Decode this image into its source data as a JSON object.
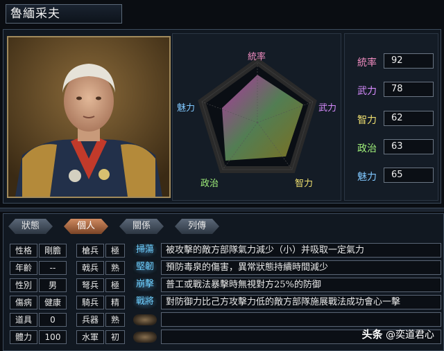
{
  "title": "魯緬采夫",
  "colors": {
    "radar_label_accent": "#f08cc0",
    "stat_pink": "#f08cc0",
    "stat_purple": "#d88cff",
    "stat_yellow": "#f0e070",
    "stat_green": "#a0f07a",
    "stat_blue": "#80c8ff"
  },
  "radar": {
    "labels": {
      "top": "統率",
      "right": "武力",
      "bottom_right": "智力",
      "bottom_left": "政治",
      "left": "魅力"
    }
  },
  "stats": [
    {
      "name": "統率",
      "value": "92"
    },
    {
      "name": "武力",
      "value": "78"
    },
    {
      "name": "智力",
      "value": "62"
    },
    {
      "name": "政治",
      "value": "63"
    },
    {
      "name": "魅力",
      "value": "65"
    }
  ],
  "tabs": [
    "狀態",
    "個人",
    "關係",
    "列傳"
  ],
  "personal": [
    {
      "label": "性格",
      "value": "剛膽"
    },
    {
      "label": "年齡",
      "value": "--"
    },
    {
      "label": "性別",
      "value": "男"
    },
    {
      "label": "傷病",
      "value": "健康"
    },
    {
      "label": "道具",
      "value": "0"
    },
    {
      "label": "體力",
      "value": "100"
    }
  ],
  "aptitudes": [
    {
      "label": "槍兵",
      "grade": "極"
    },
    {
      "label": "戟兵",
      "grade": "熟"
    },
    {
      "label": "弩兵",
      "grade": "極"
    },
    {
      "label": "騎兵",
      "grade": "精"
    },
    {
      "label": "兵器",
      "grade": "熟"
    },
    {
      "label": "水軍",
      "grade": "初"
    }
  ],
  "skills": [
    {
      "name": "掃蕩",
      "desc": "被攻擊的敵方部隊氣力減少（小）并吸取一定氣力"
    },
    {
      "name": "堅韌",
      "desc": "預防毒泉的傷害，異常狀態持續時間減少"
    },
    {
      "name": "崩擊",
      "desc": "普工或戰法暴擊時無視對方25%的防御"
    },
    {
      "name": "戰將",
      "desc": "對防御力比己方攻擊力低的敵方部隊施展戰法成功會心一擊"
    }
  ],
  "watermark": {
    "brand": "头条",
    "handle": "@奕道君心"
  }
}
